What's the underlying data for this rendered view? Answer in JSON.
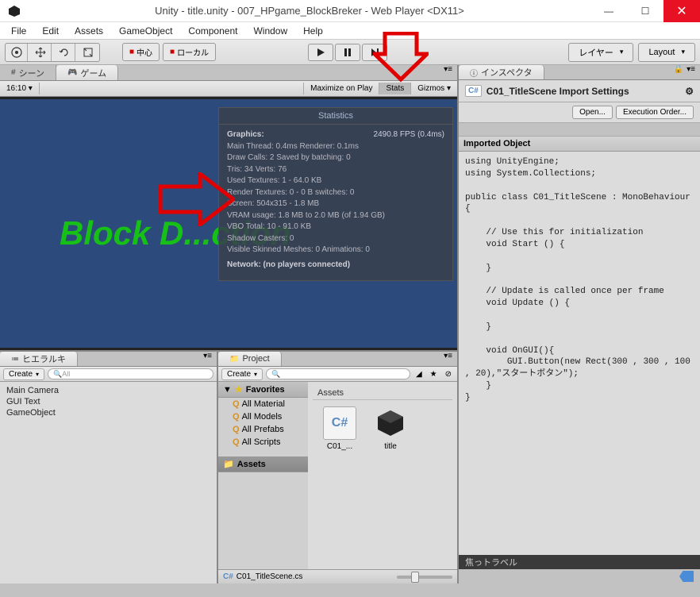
{
  "window": {
    "title": "Unity - title.unity - 007_HPgame_BlockBreker - Web Player <DX11>"
  },
  "menu": [
    "File",
    "Edit",
    "Assets",
    "GameObject",
    "Component",
    "Window",
    "Help"
  ],
  "toolbar": {
    "center_label": "中心",
    "local_label": "ローカル",
    "layers_label": "レイヤー",
    "layout_label": "Layout"
  },
  "scene_tabs": {
    "scene": "シーン",
    "game": "ゲーム"
  },
  "game_header": {
    "aspect": "16:10",
    "maximize": "Maximize on Play",
    "stats": "Stats",
    "gizmos": "Gizmos"
  },
  "game_view": {
    "overlay_text": "Block D...ction"
  },
  "stats": {
    "title": "Statistics",
    "graphics_label": "Graphics:",
    "fps": "2490.8 FPS (0.4ms)",
    "main_thread": "Main Thread: 0.4ms  Renderer: 0.1ms",
    "draw_calls": "Draw Calls: 2   Saved by batching: 0",
    "tris": "Tris: 34   Verts: 76",
    "used_tex": "Used Textures: 1 - 64.0 KB",
    "render_tex": "Render Textures: 0 - 0 B   switches: 0",
    "screen": "Screen: 504x315 - 1.8 MB",
    "vram": "VRAM usage: 1.8 MB to 2.0 MB (of 1.94 GB)",
    "vbo": "VBO Total: 10 - 91.0 KB",
    "shadow": "Shadow Casters: 0",
    "skinned": "Visible Skinned Meshes: 0      Animations: 0",
    "network": "Network: (no players connected)"
  },
  "hierarchy": {
    "tab": "ヒエラルキ",
    "create": "Create",
    "search_placeholder": "All",
    "items": [
      "Main Camera",
      "GUI Text",
      "GameObject"
    ]
  },
  "project": {
    "tab": "Project",
    "create": "Create",
    "favorites": "Favorites",
    "fav_items": [
      "All Material",
      "All Models",
      "All Prefabs",
      "All Scripts"
    ],
    "assets_folder": "Assets",
    "assets_header": "Assets",
    "assets": [
      {
        "name": "C01_...",
        "type": "cs"
      },
      {
        "name": "title",
        "type": "unity"
      }
    ],
    "footer_file": "C01_TitleScene.cs"
  },
  "inspector": {
    "tab": "インスペクタ",
    "title": "C01_TitleScene Import Settings",
    "open_btn": "Open...",
    "exec_order_btn": "Execution Order...",
    "imported_label": "Imported Object",
    "code": "using UnityEngine;\nusing System.Collections;\n\npublic class C01_TitleScene : MonoBehaviour {\n\n    // Use this for initialization\n    void Start () {\n\n    }\n\n    // Update is called once per frame\n    void Update () {\n\n    }\n\n    void OnGUI(){\n        GUI.Button(new Rect(300 , 300 , 100 , 20),\"スタートボタン\");\n    }\n}"
  },
  "status_bar": {
    "text": "焦っトラベル"
  }
}
